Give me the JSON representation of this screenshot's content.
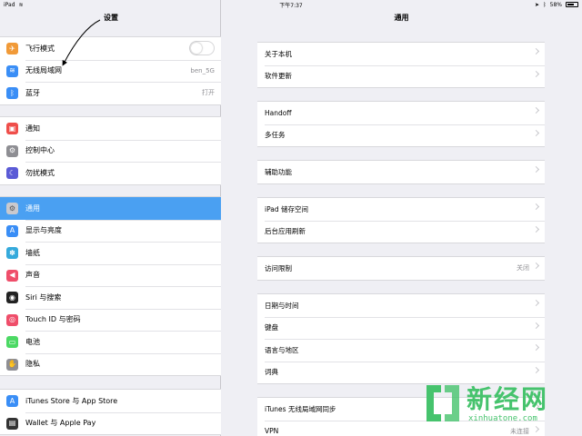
{
  "status_bar": {
    "device": "iPad",
    "time": "下午7:37",
    "battery": "58%"
  },
  "annotation": "设置",
  "sidebar": {
    "groups": [
      [
        {
          "label": "飞行模式",
          "icon": "airplane-icon",
          "color": "#f19a38",
          "glyph": "✈"
        },
        {
          "label": "无线局域网",
          "icon": "wifi-icon",
          "color": "#3a8ef6",
          "glyph": "≋",
          "value": "ben_5G"
        },
        {
          "label": "蓝牙",
          "icon": "bluetooth-icon",
          "color": "#3a8ef6",
          "glyph": "ᛒ",
          "value": "打开"
        }
      ],
      [
        {
          "label": "通知",
          "icon": "notifications-icon",
          "color": "#ef4e4a",
          "glyph": "▣"
        },
        {
          "label": "控制中心",
          "icon": "control-center-icon",
          "color": "#8e8e93",
          "glyph": "⚙"
        },
        {
          "label": "勿扰模式",
          "icon": "moon-icon",
          "color": "#5b5bd6",
          "glyph": "☾"
        }
      ],
      [
        {
          "label": "通用",
          "icon": "gear-icon",
          "color": "#8e8e93",
          "glyph": "⚙"
        },
        {
          "label": "显示与亮度",
          "icon": "display-icon",
          "color": "#3a8ef6",
          "glyph": "A"
        },
        {
          "label": "墙纸",
          "icon": "wallpaper-icon",
          "color": "#35aadc",
          "glyph": "✽"
        },
        {
          "label": "声音",
          "icon": "sound-icon",
          "color": "#ef4e6a",
          "glyph": "◀"
        },
        {
          "label": "Siri 与搜索",
          "icon": "siri-icon",
          "color": "#222",
          "glyph": "◉"
        },
        {
          "label": "Touch ID 与密码",
          "icon": "fingerprint-icon",
          "color": "#ef4e6a",
          "glyph": "◎"
        },
        {
          "label": "电池",
          "icon": "battery-icon",
          "color": "#4cd964",
          "glyph": "▭"
        },
        {
          "label": "隐私",
          "icon": "privacy-icon",
          "color": "#8e8e93",
          "glyph": "✋"
        }
      ],
      [
        {
          "label": "iTunes Store 与 App Store",
          "icon": "app-store-icon",
          "color": "#3a8ef6",
          "glyph": "A"
        },
        {
          "label": "Wallet 与 Apple Pay",
          "icon": "wallet-icon",
          "color": "#333",
          "glyph": "▤"
        }
      ]
    ]
  },
  "detail": {
    "title": "通用",
    "groups": [
      [
        {
          "label": "关于本机"
        },
        {
          "label": "软件更新"
        }
      ],
      [
        {
          "label": "Handoff"
        },
        {
          "label": "多任务"
        }
      ],
      [
        {
          "label": "辅助功能"
        }
      ],
      [
        {
          "label": "iPad 储存空间"
        },
        {
          "label": "后台应用刷新"
        }
      ],
      [
        {
          "label": "访问限制",
          "value": "关闭"
        }
      ],
      [
        {
          "label": "日期与时间"
        },
        {
          "label": "键盘"
        },
        {
          "label": "语言与地区"
        },
        {
          "label": "词典"
        }
      ],
      [
        {
          "label": "iTunes 无线局域网同步"
        },
        {
          "label": "VPN",
          "value": "未连接"
        }
      ]
    ]
  },
  "watermark": {
    "title": "新经网",
    "subtitle": "xinhuatone.com",
    "color": "#46c36d"
  }
}
